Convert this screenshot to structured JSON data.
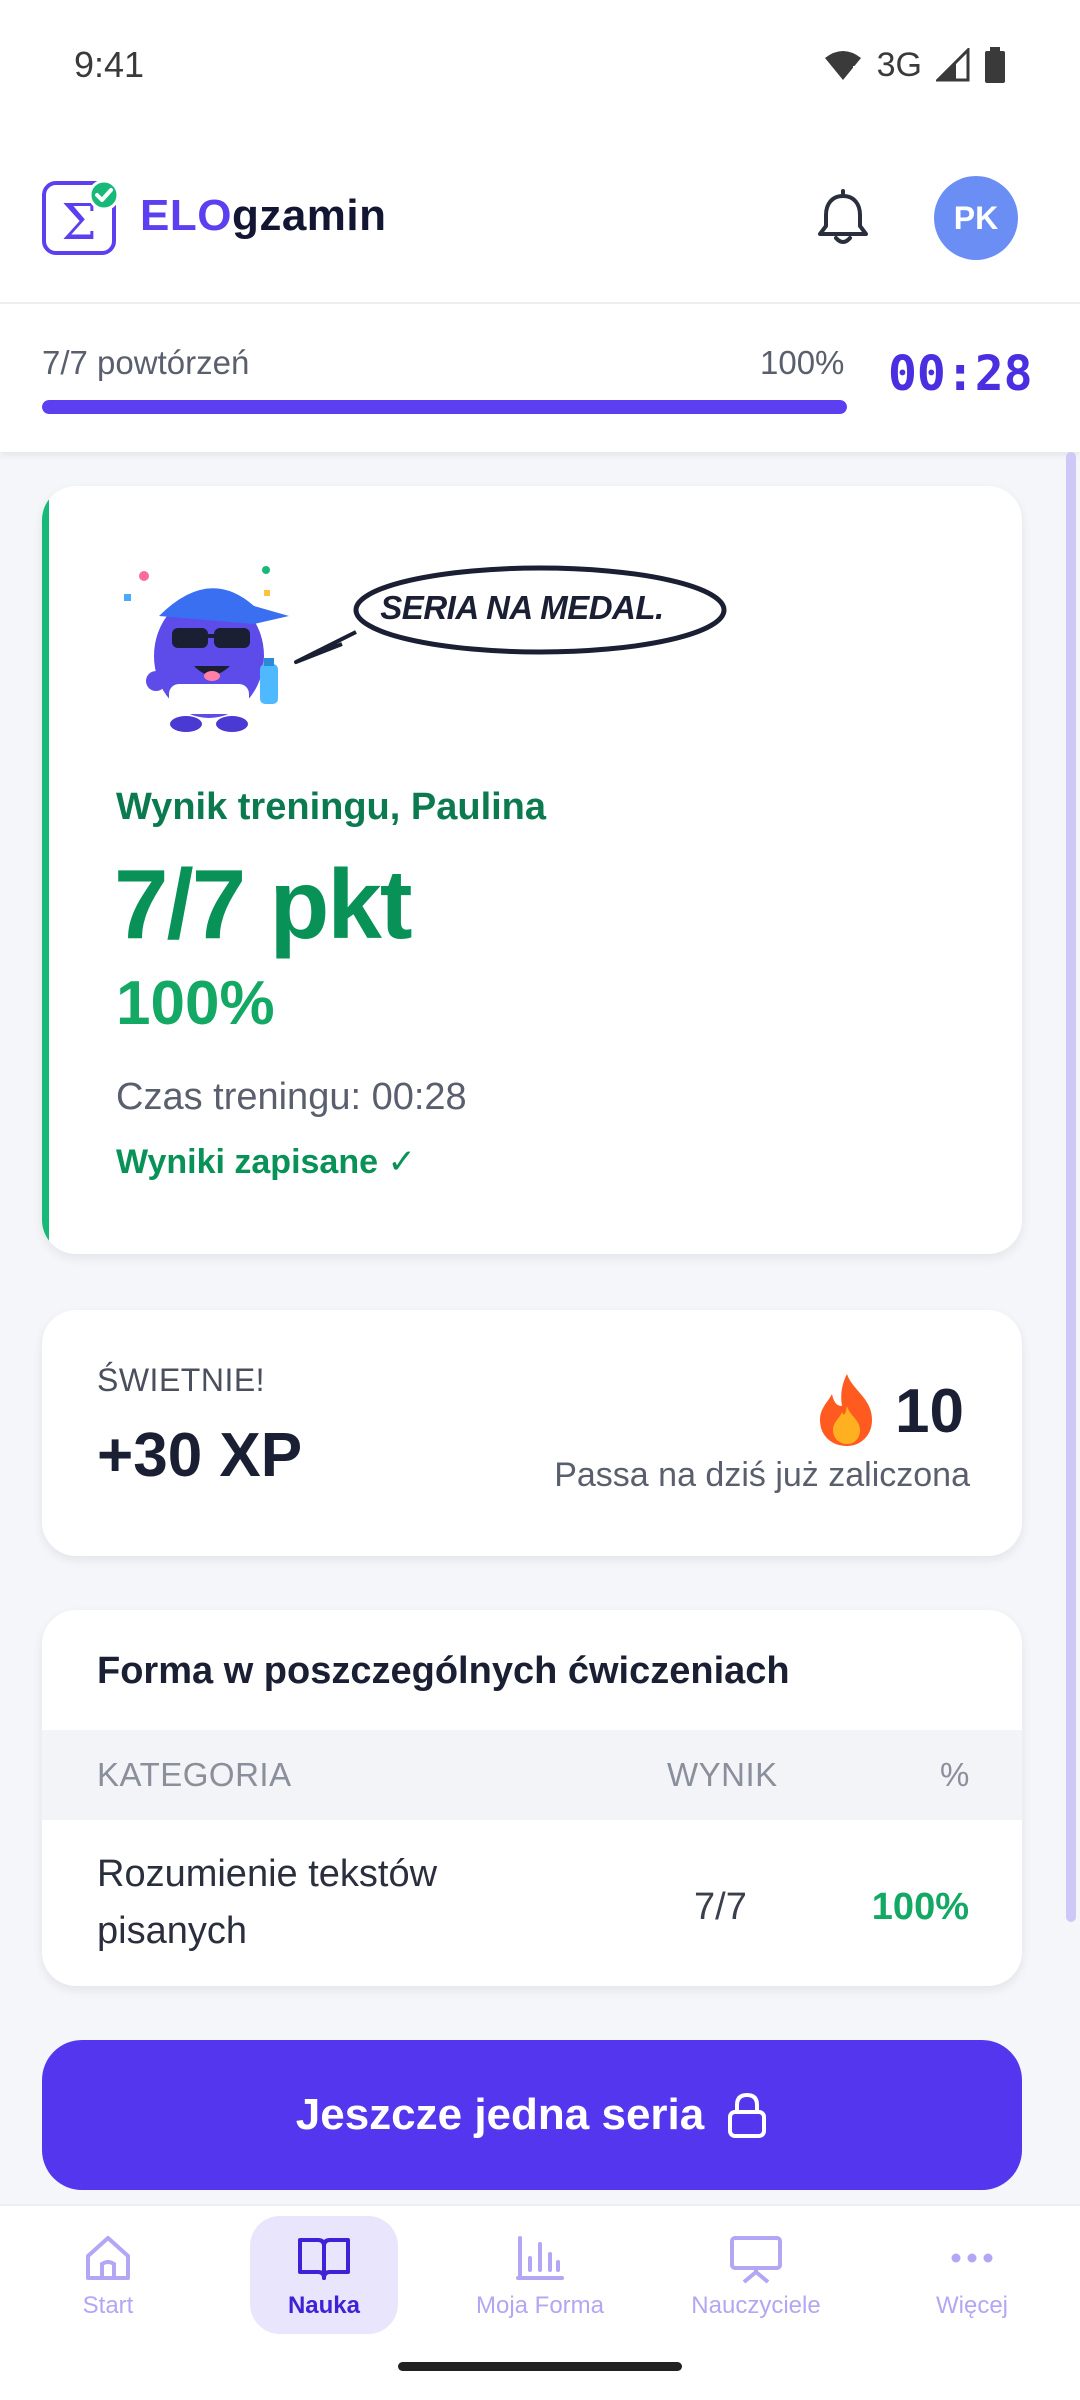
{
  "status_bar": {
    "time": "9:41",
    "network": "3G"
  },
  "header": {
    "brand_part1": "ELO",
    "brand_part2": "gzamin",
    "avatar_initials": "PK",
    "accent_color": "#5b3ff0"
  },
  "progress": {
    "label": "7/7 powtórzeń",
    "percent_label": "100%",
    "fill_fraction": 1.0,
    "timer": "00:28"
  },
  "result_card": {
    "speech_bubble": "SERIA NA MEDAL.",
    "title": "Wynik treningu, Paulina",
    "score": "7/7 pkt",
    "percent": "100%",
    "time_label": "Czas treningu: 00:28",
    "saved_label": "Wyniki zapisane ✓"
  },
  "xp_card": {
    "label": "ŚWIETNIE!",
    "xp": "+30 XP",
    "streak_count": "10",
    "streak_note": "Passa na dziś już zaliczona"
  },
  "form_table": {
    "title": "Forma w poszczególnych ćwiczeniach",
    "columns": [
      "KATEGORIA",
      "WYNIK",
      "%"
    ],
    "rows": [
      {
        "category": "Rozumienie tekstów pisanych",
        "result": "7/7",
        "percent": "100%"
      }
    ]
  },
  "cta": {
    "label": "Jeszcze jedna seria"
  },
  "bottom_nav": {
    "items": [
      {
        "label": "Start",
        "icon": "home-icon"
      },
      {
        "label": "Nauka",
        "icon": "book-icon",
        "active": true
      },
      {
        "label": "Moja Forma",
        "icon": "bar-chart-icon"
      },
      {
        "label": "Nauczyciele",
        "icon": "presentation-icon"
      },
      {
        "label": "Więcej",
        "icon": "more-dots-icon"
      }
    ]
  }
}
